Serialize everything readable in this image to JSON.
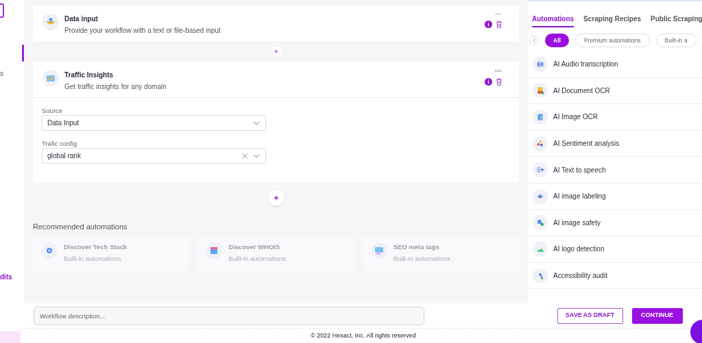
{
  "sidebar": {
    "items": [
      {
        "label": "s",
        "selected": false
      },
      {
        "label": "dits",
        "selected": true
      }
    ]
  },
  "steps": [
    {
      "title": "Data input",
      "description": "Provide your workflow with a text or file-based input",
      "expanded": false
    },
    {
      "title": "Traffic Insights",
      "description": "Get traffic insights for any domain",
      "expanded": true,
      "fields": [
        {
          "label": "Source",
          "value": "Data Input",
          "clearable": false
        },
        {
          "label": "Trafic config",
          "value": "global rank",
          "clearable": true
        }
      ]
    }
  ],
  "recommended": {
    "title": "Recommended automations",
    "items": [
      {
        "title": "Discover Tech Stack",
        "subtitle": "Built-in automations"
      },
      {
        "title": "Discover WHOIS",
        "subtitle": "Built-in automations"
      },
      {
        "title": "SEO meta tags",
        "subtitle": "Built-in automations"
      }
    ]
  },
  "panel": {
    "tabs": [
      {
        "label": "Automations",
        "selected": true
      },
      {
        "label": "Scraping Recipes",
        "selected": false
      },
      {
        "label": "Public Scraping",
        "selected": false
      }
    ],
    "filters": [
      {
        "label": "All",
        "selected": true
      },
      {
        "label": "Premium automations",
        "selected": false
      },
      {
        "label": "Built-in a",
        "selected": false
      }
    ],
    "items": [
      {
        "label": "AI Audio transcription"
      },
      {
        "label": "AI Document OCR"
      },
      {
        "label": "AI Image OCR"
      },
      {
        "label": "AI Sentiment analysis"
      },
      {
        "label": "AI Text to speech"
      },
      {
        "label": "AI image labeling"
      },
      {
        "label": "AI image safety"
      },
      {
        "label": "AI logo detection"
      },
      {
        "label": "Accessibility audit"
      }
    ]
  },
  "bottom_bar": {
    "placeholder": "Workflow description...",
    "buttons": [
      {
        "label": "SAVE AS DRAFT",
        "kind": "outline"
      },
      {
        "label": "CONTINUE",
        "kind": "solid"
      }
    ]
  },
  "footer": "© 2022 Hexact, Inc. All rights reserved"
}
